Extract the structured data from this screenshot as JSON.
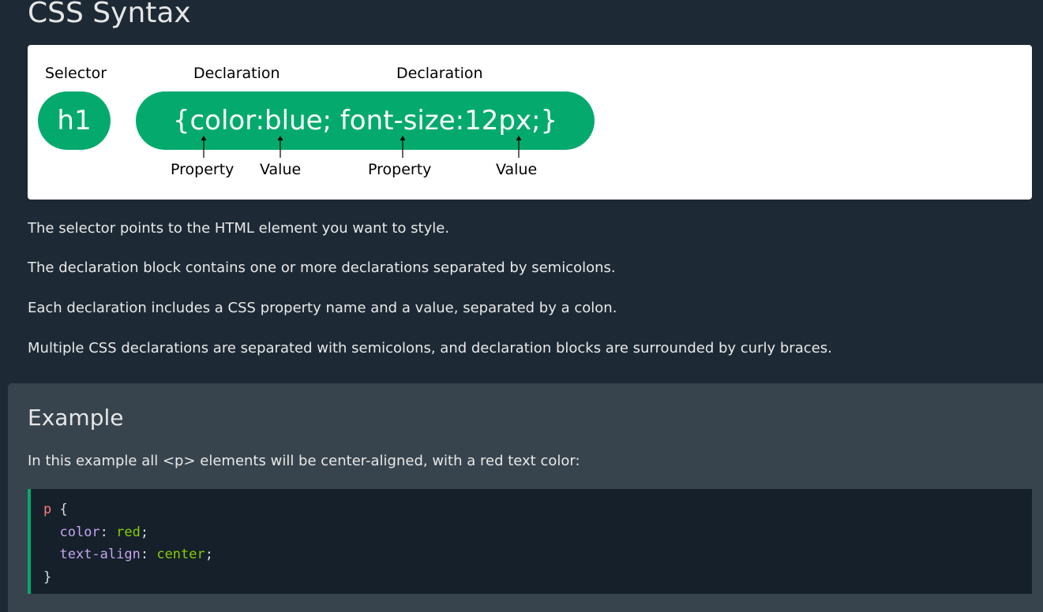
{
  "page": {
    "title": "CSS Syntax"
  },
  "diagram": {
    "labels": {
      "selector": "Selector",
      "declaration_1": "Declaration",
      "declaration_2": "Declaration",
      "property_1": "Property",
      "value_1": "Value",
      "property_2": "Property",
      "value_2": "Value"
    },
    "selector_text": "h1",
    "declaration_text": "{color:blue; font-size:12px;}",
    "accent_color": "#04aa6d"
  },
  "paragraphs": [
    "The selector points to the HTML element you want to style.",
    "The declaration block contains one or more declarations separated by semicolons.",
    "Each declaration includes a CSS property name and a value, separated by a colon.",
    "Multiple CSS declarations are separated with semicolons, and declaration blocks are surrounded by curly braces."
  ],
  "example": {
    "title": "Example",
    "description": "In this example all <p> elements will be center-aligned, with a red text color:",
    "code": {
      "selector": "p",
      "open_brace": " {",
      "prop1": "color",
      "val1": "red",
      "prop2": "text-align",
      "val2": "center",
      "close_brace": "}"
    }
  },
  "colors": {
    "page_background": "#1d2a35",
    "example_background": "#38444d",
    "code_background": "#15202b",
    "selector_color": "#ff7a7a",
    "property_color": "#c6a3f0",
    "value_color": "#88ce02"
  }
}
